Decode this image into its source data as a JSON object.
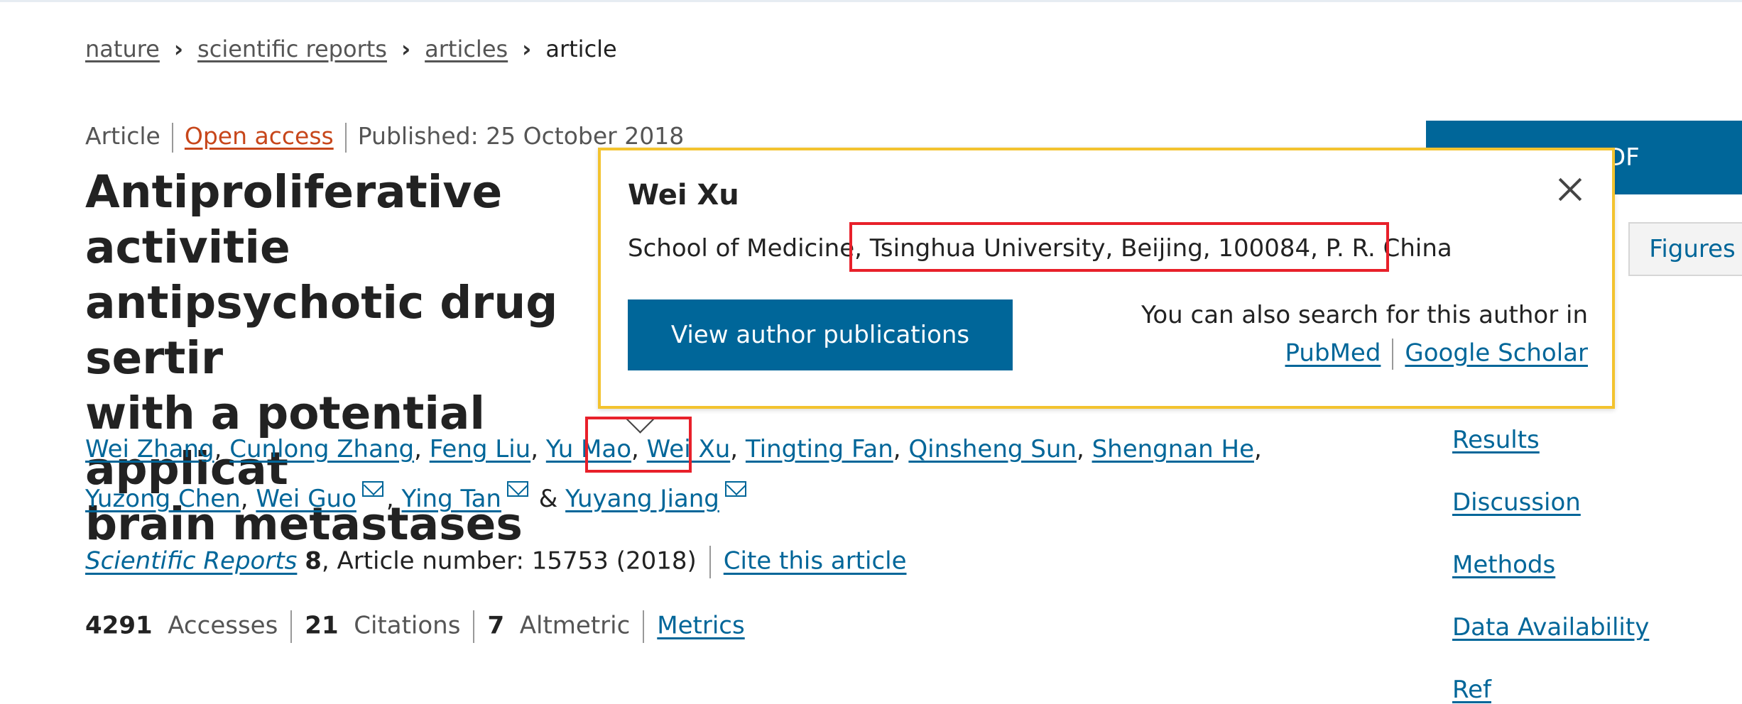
{
  "breadcrumb": {
    "items": [
      "nature",
      "scientific reports",
      "articles",
      "article"
    ]
  },
  "meta": {
    "type": "Article",
    "access": "Open access",
    "published": "Published: 25 October 2018"
  },
  "title": {
    "lines": [
      "Antiproliferative activitie",
      "antipsychotic drug sertir",
      "with a potential applicat",
      "brain metastases"
    ]
  },
  "authors": {
    "list": [
      "Wei Zhang",
      "Cunlong Zhang",
      "Feng Liu",
      "Yu Mao",
      "Wei Xu",
      "Tingting Fan",
      "Qinsheng Sun",
      "Shengnan He",
      "Yuzong Chen",
      "Wei Guo",
      "Ying Tan",
      "Yuyang Jiang"
    ],
    "separator": ",",
    "and": "&"
  },
  "citation": {
    "journal": "Scientific Reports",
    "volume": "8",
    "article_number": ", Article number: 15753 (2018)",
    "cite_link": "Cite this article"
  },
  "metrics": {
    "accesses_count": "4291",
    "accesses_label": "Accesses",
    "citations_count": "21",
    "citations_label": "Citations",
    "altmetric_count": "7",
    "altmetric_label": "Altmetric",
    "metrics_link": "Metrics"
  },
  "sidebar": {
    "pdf_button": "DF",
    "figures_tab": "Figures",
    "toc": [
      "Results",
      "Discussion",
      "Methods",
      "Data Availability",
      "Ref"
    ]
  },
  "popover": {
    "name": "Wei Xu",
    "affiliation_prefix": "School of Medicine, ",
    "affiliation_highlight": "Tsinghua University, Beijing, 100084, P. R. China",
    "button": "View author publications",
    "search_text": "You can also search for this author in",
    "links": [
      "PubMed",
      "Google Scholar"
    ]
  },
  "colors": {
    "link": "#006699",
    "open_access": "#c7461a",
    "popover_border": "#f3c32f",
    "highlight": "#e8202a"
  }
}
